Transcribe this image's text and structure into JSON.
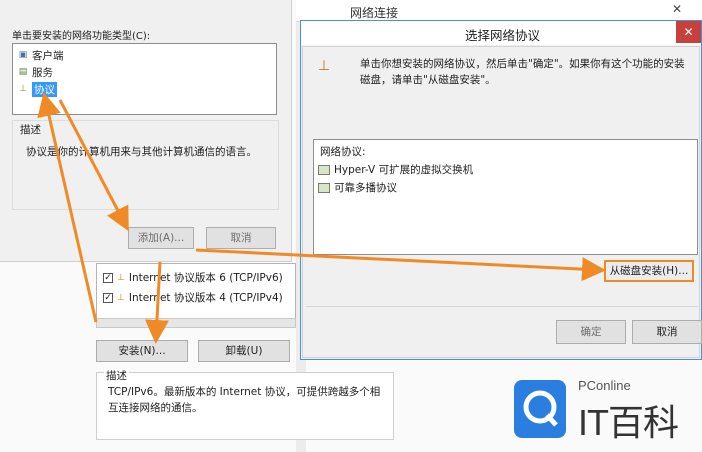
{
  "background_window": {
    "title": "网络连接",
    "close_glyph": "✕"
  },
  "left_dialog": {
    "prompt": "单击要安装的网络功能类型(C):",
    "types": [
      {
        "label": "客户端",
        "icon": "client-icon",
        "selected": false
      },
      {
        "label": "服务",
        "icon": "service-icon",
        "selected": false
      },
      {
        "label": "协议",
        "icon": "protocol-icon",
        "selected": true
      }
    ],
    "description_label": "描述",
    "description_text": "协议是你的计算机用来与其他计算机通信的语言。",
    "add_button": "添加(A)...",
    "cancel_button": "取消"
  },
  "properties": {
    "items": [
      {
        "label": "Internet 协议版本 6 (TCP/IPv6)",
        "checked": true
      },
      {
        "label": "Internet 协议版本 4 (TCP/IPv4)",
        "checked": true
      }
    ],
    "install_button": "安装(N)...",
    "uninstall_button": "卸载(U)",
    "description_label": "描述",
    "description_text": "TCP/IPv6。最新版本的 Internet 协议，可提供跨越多个相互连接网络的通信。"
  },
  "protocol_dialog": {
    "title": "选择网络协议",
    "close_glyph": "✕",
    "instruction": "单击你想安装的网络协议，然后单击\"确定\"。如果你有这个功能的安装磁盘，请单击\"从磁盘安装\"。",
    "list_header": "网络协议:",
    "protocols": [
      {
        "label": "Hyper-V 可扩展的虚拟交换机"
      },
      {
        "label": "可靠多播协议"
      }
    ],
    "have_disk_button": "从磁盘安装(H)...",
    "ok_button": "确定",
    "cancel_button": "取消"
  },
  "watermark": {
    "brand_small": "PConline",
    "brand_large": "IT百科"
  },
  "colors": {
    "arrow": "#f08a24",
    "selection": "#3399ff",
    "close_red": "#c7403b",
    "title_border": "#4a90d8"
  }
}
